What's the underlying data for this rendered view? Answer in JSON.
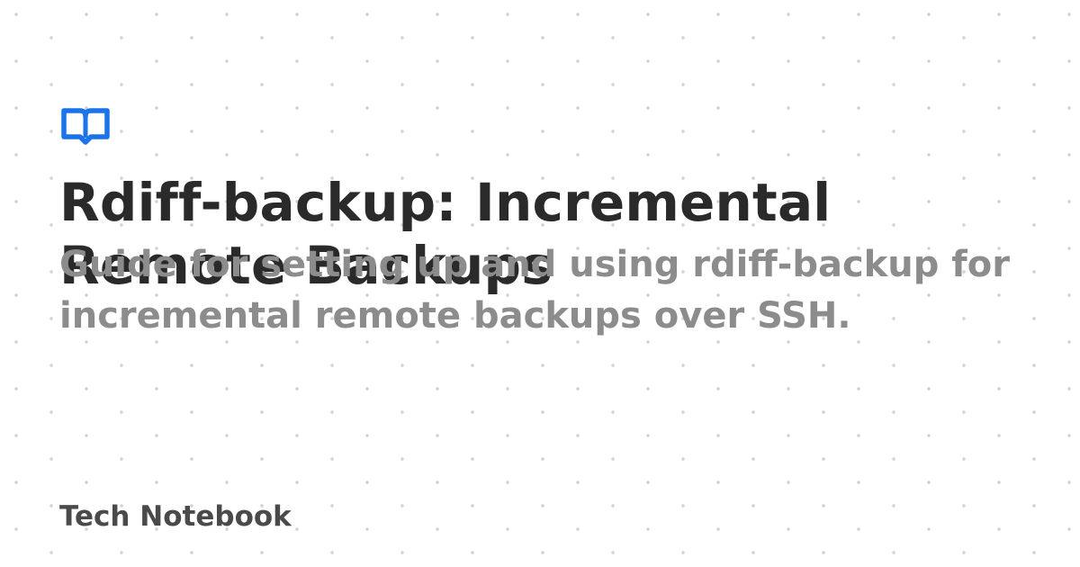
{
  "card": {
    "title": "Rdiff-backup: Incremental Remote Backups",
    "subtitle": "Guide for setting up and using rdiff-backup for incremental remote backups over SSH.",
    "site_name": "Tech Notebook",
    "logo_icon": "book-open-icon",
    "colors": {
      "accent": "#1a73e8",
      "title": "#2a2a2a",
      "subtitle": "#8c8c8c",
      "brand": "#4a4a4a",
      "background": "#ffffff",
      "dots": "#d2d2d2"
    }
  }
}
